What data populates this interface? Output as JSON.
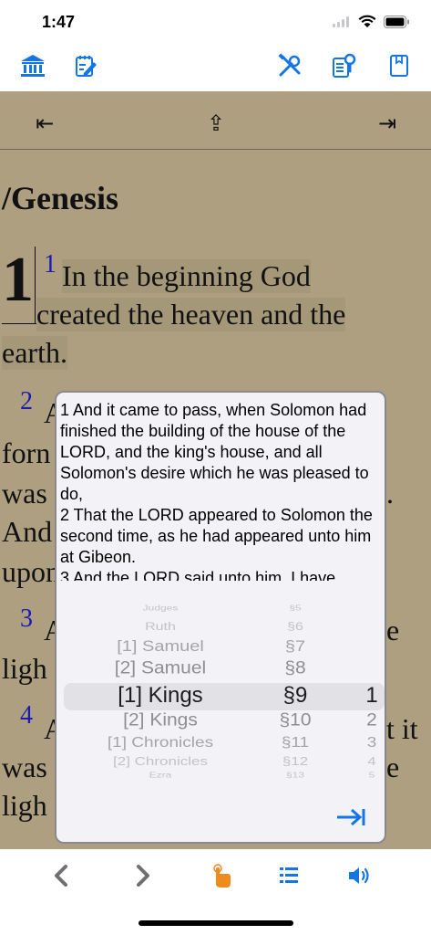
{
  "status": {
    "time": "1:47"
  },
  "toolbar": {
    "library_icon": "bank-building-icon",
    "notes_icon": "notepad-pencil-icon",
    "tools_icon": "wrench-screwdriver-icon",
    "search_icon": "document-search-icon",
    "bookmark_icon": "bookmark-icon"
  },
  "reader": {
    "book_title": "/Genesis",
    "chapter": "1",
    "verse1": {
      "num": "1",
      "line1": "In the beginning God",
      "line2": "created the heaven and the",
      "line3": "earth."
    },
    "verse2": {
      "num": "2",
      "l1": "A",
      "l2": "forn",
      "l3": "was",
      "l3r": ".",
      "l4": "And",
      "l5": "upon"
    },
    "verse3": {
      "num": "3",
      "l1": "A",
      "l1r": "e",
      "l2": "ligh"
    },
    "verse4": {
      "num": "4",
      "l1": "A",
      "l1r": "t it",
      "l2": "was",
      "l2r": "e",
      "l3": "ligh"
    }
  },
  "popup": {
    "verses": [
      "1 And it came to pass, when Solomon had finished the building of the house of the LORD, and the king's house, and all Solomon's desire which he was pleased to do,",
      "2 That the LORD appeared to Solomon the second time, as he had appeared unto him at Gibeon.",
      "3 And the LORD said unto him, I have"
    ],
    "picker": {
      "books": [
        "Judges",
        "Ruth",
        "[1] Samuel",
        "[2] Samuel",
        "[1] Kings",
        "[2] Kings",
        "[1] Chronicles",
        "[2] Chronicles",
        "Ezra"
      ],
      "chapters": [
        "§5",
        "§6",
        "§7",
        "§8",
        "§9",
        "§10",
        "§11",
        "§12",
        "§13"
      ],
      "verses": [
        "",
        "",
        "",
        "",
        "1",
        "2",
        "3",
        "4",
        "5"
      ],
      "selected_index": 4
    },
    "goto_icon": "arrow-right-to-bar-icon"
  },
  "colors": {
    "accent": "#1476e6",
    "parchment": "#ad9f80",
    "verse_number": "#1b1bb0",
    "touch_icon": "#f08a1c"
  }
}
